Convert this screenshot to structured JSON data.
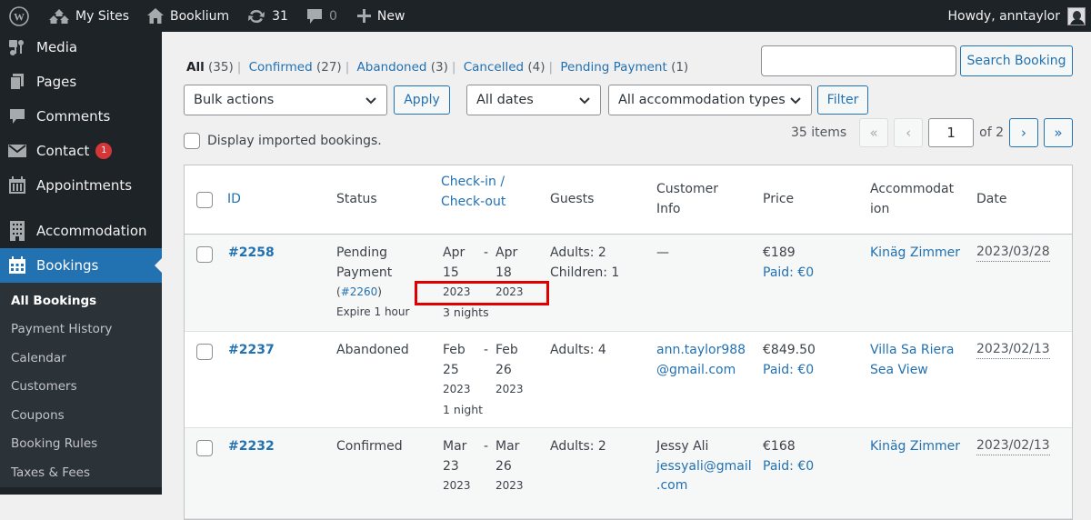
{
  "adminbar": {
    "wp_logo": "wordpress-logo",
    "my_sites": "My Sites",
    "site_name": "Booklium",
    "updates_count": "31",
    "comments_count": "0",
    "new_label": "New",
    "howdy": "Howdy, anntaylor"
  },
  "sidebar": {
    "items": [
      {
        "label": "Media",
        "icon": "media-icon"
      },
      {
        "label": "Pages",
        "icon": "pages-icon"
      },
      {
        "label": "Comments",
        "icon": "comments-icon"
      },
      {
        "label": "Contact",
        "icon": "envelope-icon",
        "badge": "1"
      },
      {
        "label": "Appointments",
        "icon": "calendar-icon"
      },
      {
        "label": "Accommodation",
        "icon": "building-icon"
      },
      {
        "label": "Bookings",
        "icon": "calendar-icon",
        "current": true
      }
    ],
    "submenu": [
      {
        "label": "All Bookings",
        "current": true
      },
      {
        "label": "Payment History"
      },
      {
        "label": "Calendar"
      },
      {
        "label": "Customers"
      },
      {
        "label": "Coupons"
      },
      {
        "label": "Booking Rules"
      },
      {
        "label": "Taxes & Fees"
      }
    ]
  },
  "filters": {
    "views": [
      {
        "label": "All",
        "count": "(35)",
        "current": true
      },
      {
        "label": "Confirmed",
        "count": "(27)"
      },
      {
        "label": "Abandoned",
        "count": "(3)"
      },
      {
        "label": "Cancelled",
        "count": "(4)"
      },
      {
        "label": "Pending Payment",
        "count": "(1)"
      }
    ],
    "search_value": "",
    "search_button": "Search Booking",
    "bulk_actions": "Bulk actions",
    "apply": "Apply",
    "dates": "All dates",
    "accommodation_types": "All accommodation types",
    "filter": "Filter",
    "display_imported": "Display imported bookings."
  },
  "pagination": {
    "items": "35 items",
    "first": "«",
    "prev": "‹",
    "current_page": "1",
    "of": "of 2",
    "next": "›",
    "last": "»"
  },
  "table": {
    "columns": {
      "id": "ID",
      "status": "Status",
      "checkin_1": "Check-in /",
      "checkin_2": "Check-out",
      "guests": "Guests",
      "customer_1": "Customer",
      "customer_2": "Info",
      "price": "Price",
      "accommodation_1": "Accommodat",
      "accommodation_2": "ion",
      "date": "Date"
    },
    "rows": [
      {
        "id": "#2258",
        "status_1": "Pending",
        "status_2": "Payment",
        "status_link_open": "(",
        "status_link": "#2260",
        "status_link_close": ")",
        "status_note": "Expire 1 hour",
        "in_month": "Apr",
        "in_day": "15",
        "in_year": "2023",
        "sep": "-",
        "out_month": "Apr",
        "out_day": "18",
        "out_year": "2023",
        "nights": "3 nights",
        "guests_1": "Adults: 2",
        "guests_2": "Children: 1",
        "customer_1": "—",
        "customer_2": "",
        "customer_3": "",
        "price": "€189",
        "paid": "Paid: €0",
        "accommodation_1": "Kinäg Zimmer",
        "accommodation_2": "",
        "date": "2023/03/28"
      },
      {
        "id": "#2237",
        "status_1": "Abandoned",
        "in_month": "Feb",
        "in_day": "25",
        "in_year": "2023",
        "sep": "-",
        "out_month": "Feb",
        "out_day": "26",
        "out_year": "2023",
        "nights": "1 night",
        "guests_1": "Adults: 4",
        "customer_1": "ann.taylor988",
        "customer_2": "@gmail.com",
        "price": "€849.50",
        "paid": "Paid: €0",
        "accommodation_1": "Villa Sa Riera",
        "accommodation_2": "Sea View",
        "date": "2023/02/13"
      },
      {
        "id": "#2232",
        "status_1": "Confirmed",
        "in_month": "Mar",
        "in_day": "23",
        "in_year": "2023",
        "sep": "-",
        "out_month": "Mar",
        "out_day": "26",
        "out_year": "2023",
        "guests_1": "Adults: 2",
        "customer_name": "Jessy Ali",
        "customer_1": "jessyali@gmail",
        "customer_2": ".com",
        "price": "€168",
        "paid": "Paid: €0",
        "accommodation_1": "Kinäg Zimmer",
        "date": "2023/02/13"
      }
    ]
  },
  "colors": {
    "admin_bar": "#1d2327",
    "accent": "#2271b1",
    "highlight_box": "#e00000",
    "badge": "#d63638"
  }
}
